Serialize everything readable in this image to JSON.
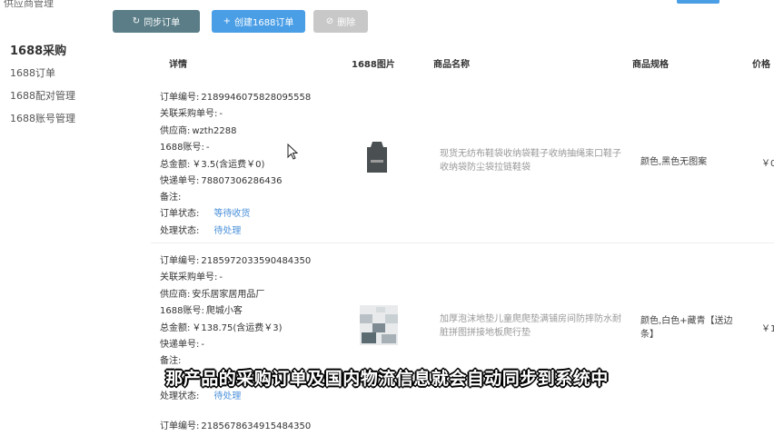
{
  "sidebar": {
    "supplier_label": "供应商管理",
    "section_title": "1688采购",
    "items": [
      {
        "label": "1688订单"
      },
      {
        "label": "1688配对管理"
      },
      {
        "label": "1688账号管理"
      }
    ]
  },
  "toolbar": {
    "sync_label": "同步订单",
    "new_label": "创建1688订单",
    "delete_label": "删除"
  },
  "table": {
    "headers": [
      "详情",
      "1688图片",
      "商品名称",
      "商品规格",
      "价格"
    ]
  },
  "labels": {
    "order_no": "订单编号:",
    "related_no": "关联采购单号:",
    "supplier": "供应商:",
    "account": "1688账号:",
    "total": "总金额:",
    "tracking": "快递单号:",
    "note": "备注:",
    "status": "订单状态:",
    "handle": "处理状态:"
  },
  "orders": [
    {
      "order_no": "2189946075828095558",
      "related_no": "-",
      "supplier": "wzth2288",
      "account": "-",
      "total": "￥3.5(含运费￥0)",
      "tracking": "78807306286436",
      "note": "",
      "status": "等待收货",
      "handle": "待处理",
      "product_name": "现货无纺布鞋袋收纳袋鞋子收纳抽绳束口鞋子收纳袋防尘袋拉链鞋袋",
      "spec": "颜色,黑色无图案",
      "price": "￥0"
    },
    {
      "order_no": "2185972033590484350",
      "related_no": "-",
      "supplier": "安乐居家居用品厂",
      "account": "爬城小客",
      "total": "￥138.75(含运费￥3)",
      "tracking": "-",
      "note": "",
      "status": "",
      "handle": "待处理",
      "product_name": "加厚泡沫地垫儿童爬爬垫满铺房间防摔防水耐脏拼图拼接地板爬行垫",
      "spec": "颜色,白色+藏青【送边条】",
      "price": "￥1"
    },
    {
      "order_no": "2185678634915484350"
    }
  ],
  "subtitle": "那产品的采购订单及国内物流信息就会自动同步到系统中",
  "colors": {
    "primary": "#4a9ee6",
    "link": "#4a90d9",
    "sync_button": "#5a7d87",
    "disabled": "#c8c8c8"
  }
}
